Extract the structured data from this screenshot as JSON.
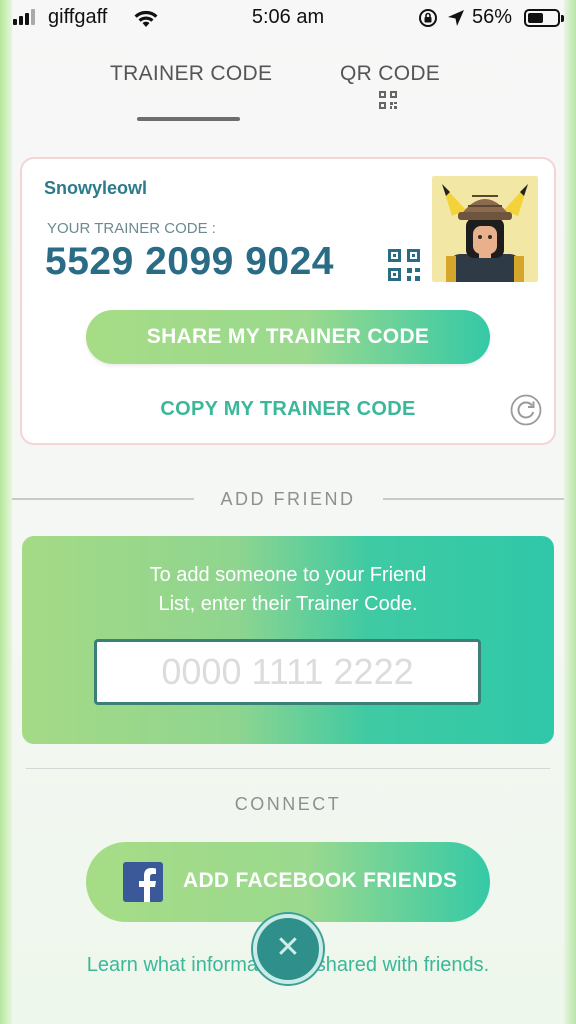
{
  "status_bar": {
    "carrier": "giffgaff",
    "time": "5:06 am",
    "battery_percent": "56%",
    "battery_level": 0.56,
    "icons": [
      "signal-icon",
      "wifi-icon",
      "rotation-lock-icon",
      "location-arrow-icon",
      "battery-icon"
    ]
  },
  "tabs": {
    "trainer_code": "TRAINER CODE",
    "qr_code": "QR CODE",
    "active": "trainer_code"
  },
  "trainer_card": {
    "username": "Snowyleowl",
    "code_label": "YOUR TRAINER CODE :",
    "code": "5529 2099 9024",
    "share_button": "SHARE MY TRAINER CODE",
    "copy_link": "COPY MY TRAINER CODE"
  },
  "add_friend": {
    "title": "ADD FRIEND",
    "instruction_line1": "To add someone to your Friend",
    "instruction_line2": "List, enter their Trainer Code.",
    "input_placeholder": "0000 1111 2222",
    "input_value": ""
  },
  "connect": {
    "title": "CONNECT",
    "facebook_button": "ADD FACEBOOK FRIENDS",
    "learn_link": "Learn what information is shared with friends."
  },
  "colors": {
    "accent_teal": "#3bb79a",
    "code_blue": "#2a6b85",
    "button_green": "#a6dc86",
    "button_teal": "#34c9a6",
    "facebook_blue": "#3b5998",
    "close_button": "#2f8f8b"
  }
}
